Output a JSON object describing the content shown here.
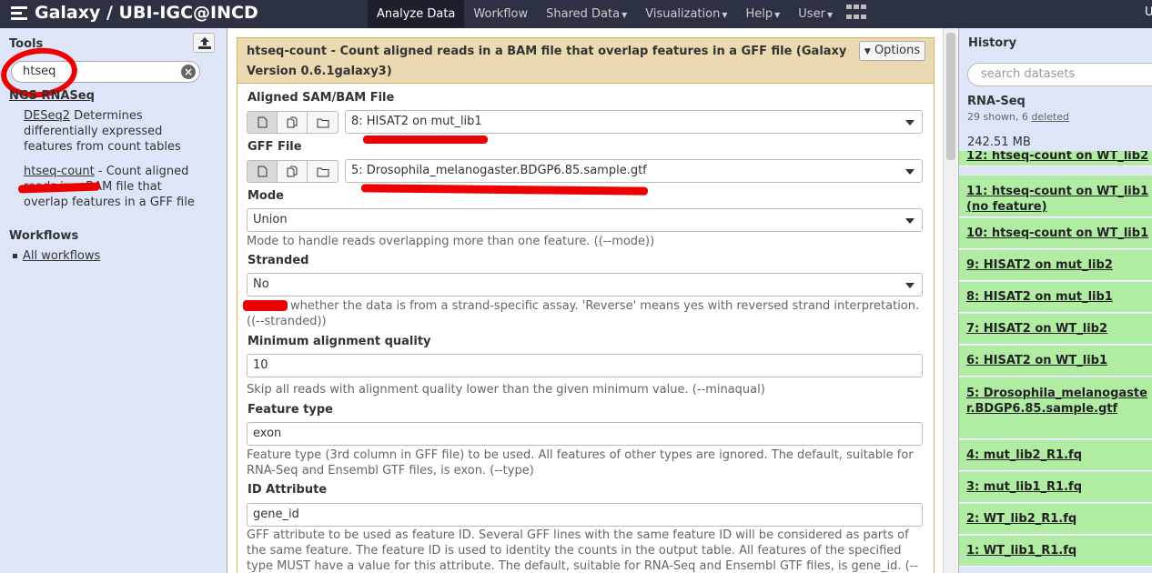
{
  "masthead": {
    "brand": "Galaxy / UBI-IGC@INCD",
    "nav": [
      {
        "label": "Analyze Data",
        "dropdown": false
      },
      {
        "label": "Workflow",
        "dropdown": false
      },
      {
        "label": "Shared Data",
        "dropdown": true
      },
      {
        "label": "Visualization",
        "dropdown": true
      },
      {
        "label": "Help",
        "dropdown": true
      },
      {
        "label": "User",
        "dropdown": true
      }
    ],
    "apps_icon": "grid-icon",
    "user_initial": "U"
  },
  "tools_panel": {
    "title": "Tools",
    "upload_icon": "upload-icon",
    "search_value": "htseq",
    "section": "NGS RNASeq",
    "tools": [
      {
        "link": "DESeq2",
        "description": " Determines differentially expressed features from count tables"
      },
      {
        "link": "htseq-count",
        "description": " - Count aligned reads in a BAM file that overlap features in a GFF file"
      }
    ],
    "workflows_title": "Workflows",
    "all_workflows": "All workflows"
  },
  "tool_form": {
    "title": "htseq-count - Count aligned reads in a BAM file that overlap features in a GFF file (Galaxy Version 0.6.1galaxy3)",
    "options_label": "Options",
    "aligned_label": "Aligned SAM/BAM File",
    "aligned_value": "8: HISAT2 on mut_lib1",
    "gff_label": "GFF File",
    "gff_value": "5: Drosophila_melanogaster.BDGP6.85.sample.gtf",
    "mode_label": "Mode",
    "mode_value": "Union",
    "mode_help": "Mode to handle reads overlapping more than one feature. ((--mode))",
    "stranded_label": "Stranded",
    "stranded_value": "No",
    "stranded_help": " whether the data is from a strand-specific assay. 'Reverse' means yes with reversed strand interpretation. ((--stranded))",
    "minqual_label": "Minimum alignment quality",
    "minqual_value": "10",
    "minqual_help": "Skip all reads with alignment quality lower than the given minimum value. (--minaqual)",
    "feature_label": "Feature type",
    "feature_value": "exon",
    "feature_help": "Feature type (3rd column in GFF file) to be used. All features of other types are ignored. The default, suitable for RNA-Seq and Ensembl GTF files, is exon. (--type)",
    "idattr_label": "ID Attribute",
    "idattr_value": "gene_id",
    "idattr_help": "GFF attribute to be used as feature ID. Several GFF lines with the same feature ID will be considered as parts of the same feature. The feature ID is used to identity the counts in the output table. All features of the specified type MUST have a value for this attribute. The default, suitable for RNA-Seq and Ensembl GTF files, is gene_id. (--idattr)"
  },
  "history": {
    "title": "History",
    "search_placeholder": "search datasets",
    "name": "RNA-Seq",
    "shown_text": "29 shown, 6 ",
    "deleted_link": "deleted",
    "size": "242.51 MB",
    "datasets": [
      "12: htseq-count on WT_lib2",
      "11: htseq-count on WT_lib1 (no feature)",
      "10: htseq-count on WT_lib1",
      "9: HISAT2 on mut_lib2",
      "8: HISAT2 on mut_lib1",
      "7: HISAT2 on WT_lib2",
      "6: HISAT2 on WT_lib1",
      "5: Drosophila_melanogaster.BDGP6.85.sample.gtf",
      "4: mut_lib2_R1.fq",
      "3: mut_lib1_R1.fq",
      "2: WT_lib2_R1.fq",
      "1: WT_lib1_R1.fq"
    ],
    "dataset_color": "#b0eda3"
  }
}
